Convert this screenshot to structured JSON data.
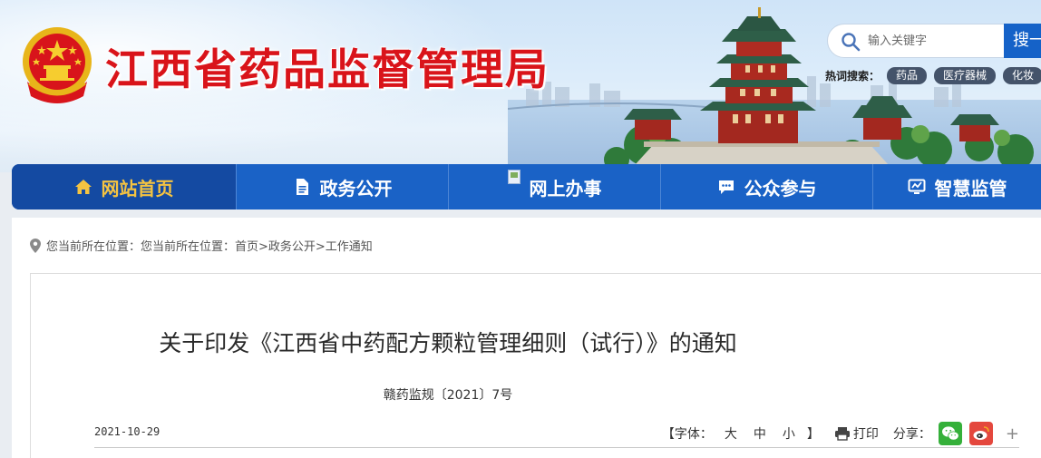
{
  "header": {
    "site_title": "江西省药品监督管理局",
    "search": {
      "placeholder": "输入关键字",
      "button_label": "搜一"
    },
    "hot": {
      "label": "热词搜索：",
      "tags": [
        "药品",
        "医疗器械",
        "化妆"
      ]
    }
  },
  "nav": {
    "items": [
      {
        "label": "网站首页",
        "icon": "home-icon",
        "active": true
      },
      {
        "label": "政务公开",
        "icon": "document-icon",
        "active": false
      },
      {
        "label": "网上办事",
        "icon": "broken-image-icon",
        "active": false
      },
      {
        "label": "公众参与",
        "icon": "chat-icon",
        "active": false
      },
      {
        "label": "智慧监管",
        "icon": "monitor-icon",
        "active": false
      }
    ]
  },
  "breadcrumb": {
    "text": "您当前所在位置：您当前所在位置：首页>政务公开>工作通知"
  },
  "article": {
    "title": "关于印发《江西省中药配方颗粒管理细则（试行）》的通知",
    "doc_number": "赣药监规〔2021〕7号",
    "date": "2021-10-29",
    "font_size": {
      "label": "【字体：",
      "large": "大",
      "medium": "中",
      "small": "小",
      "close": "】"
    },
    "print_label": "打印",
    "share_label": "分享：",
    "share_more": "+"
  },
  "colors": {
    "title_red": "#d9141a",
    "nav_blue": "#1a62c6",
    "nav_active": "#144aa2",
    "nav_active_text": "#f5c341"
  }
}
